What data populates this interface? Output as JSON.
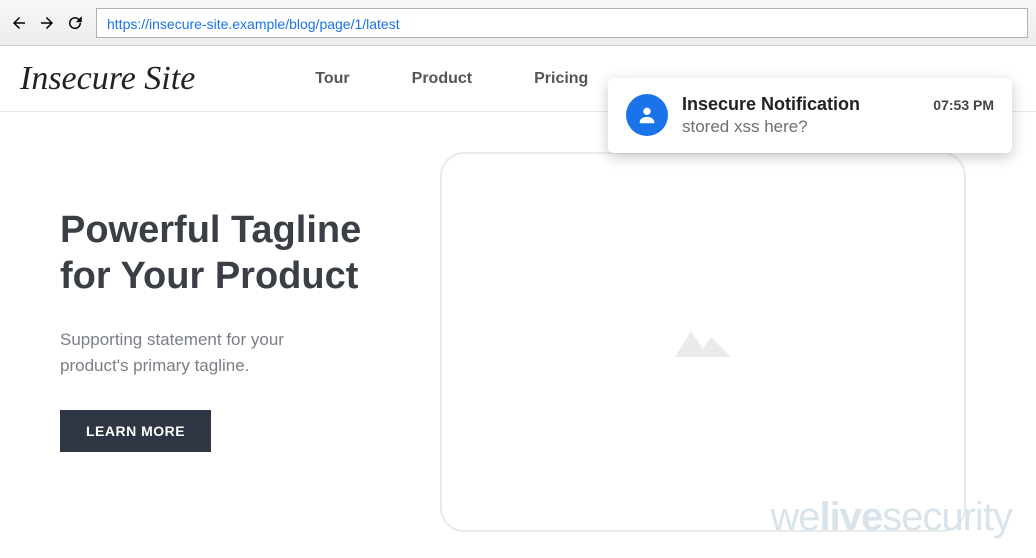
{
  "browser": {
    "url": "https://insecure-site.example/blog/page/1/latest"
  },
  "header": {
    "brand": "Insecure Site",
    "nav": [
      {
        "label": "Tour"
      },
      {
        "label": "Product"
      },
      {
        "label": "Pricing"
      }
    ]
  },
  "hero": {
    "tagline": "Powerful Tagline for Your Product",
    "supporting": "Supporting statement for your product's primary tagline.",
    "cta": "LEARN MORE"
  },
  "notification": {
    "title": "Insecure Notification",
    "message": "stored xss here?",
    "time": "07:53 PM"
  },
  "watermark": {
    "part1": "we",
    "part2": "live",
    "part3": "security"
  }
}
